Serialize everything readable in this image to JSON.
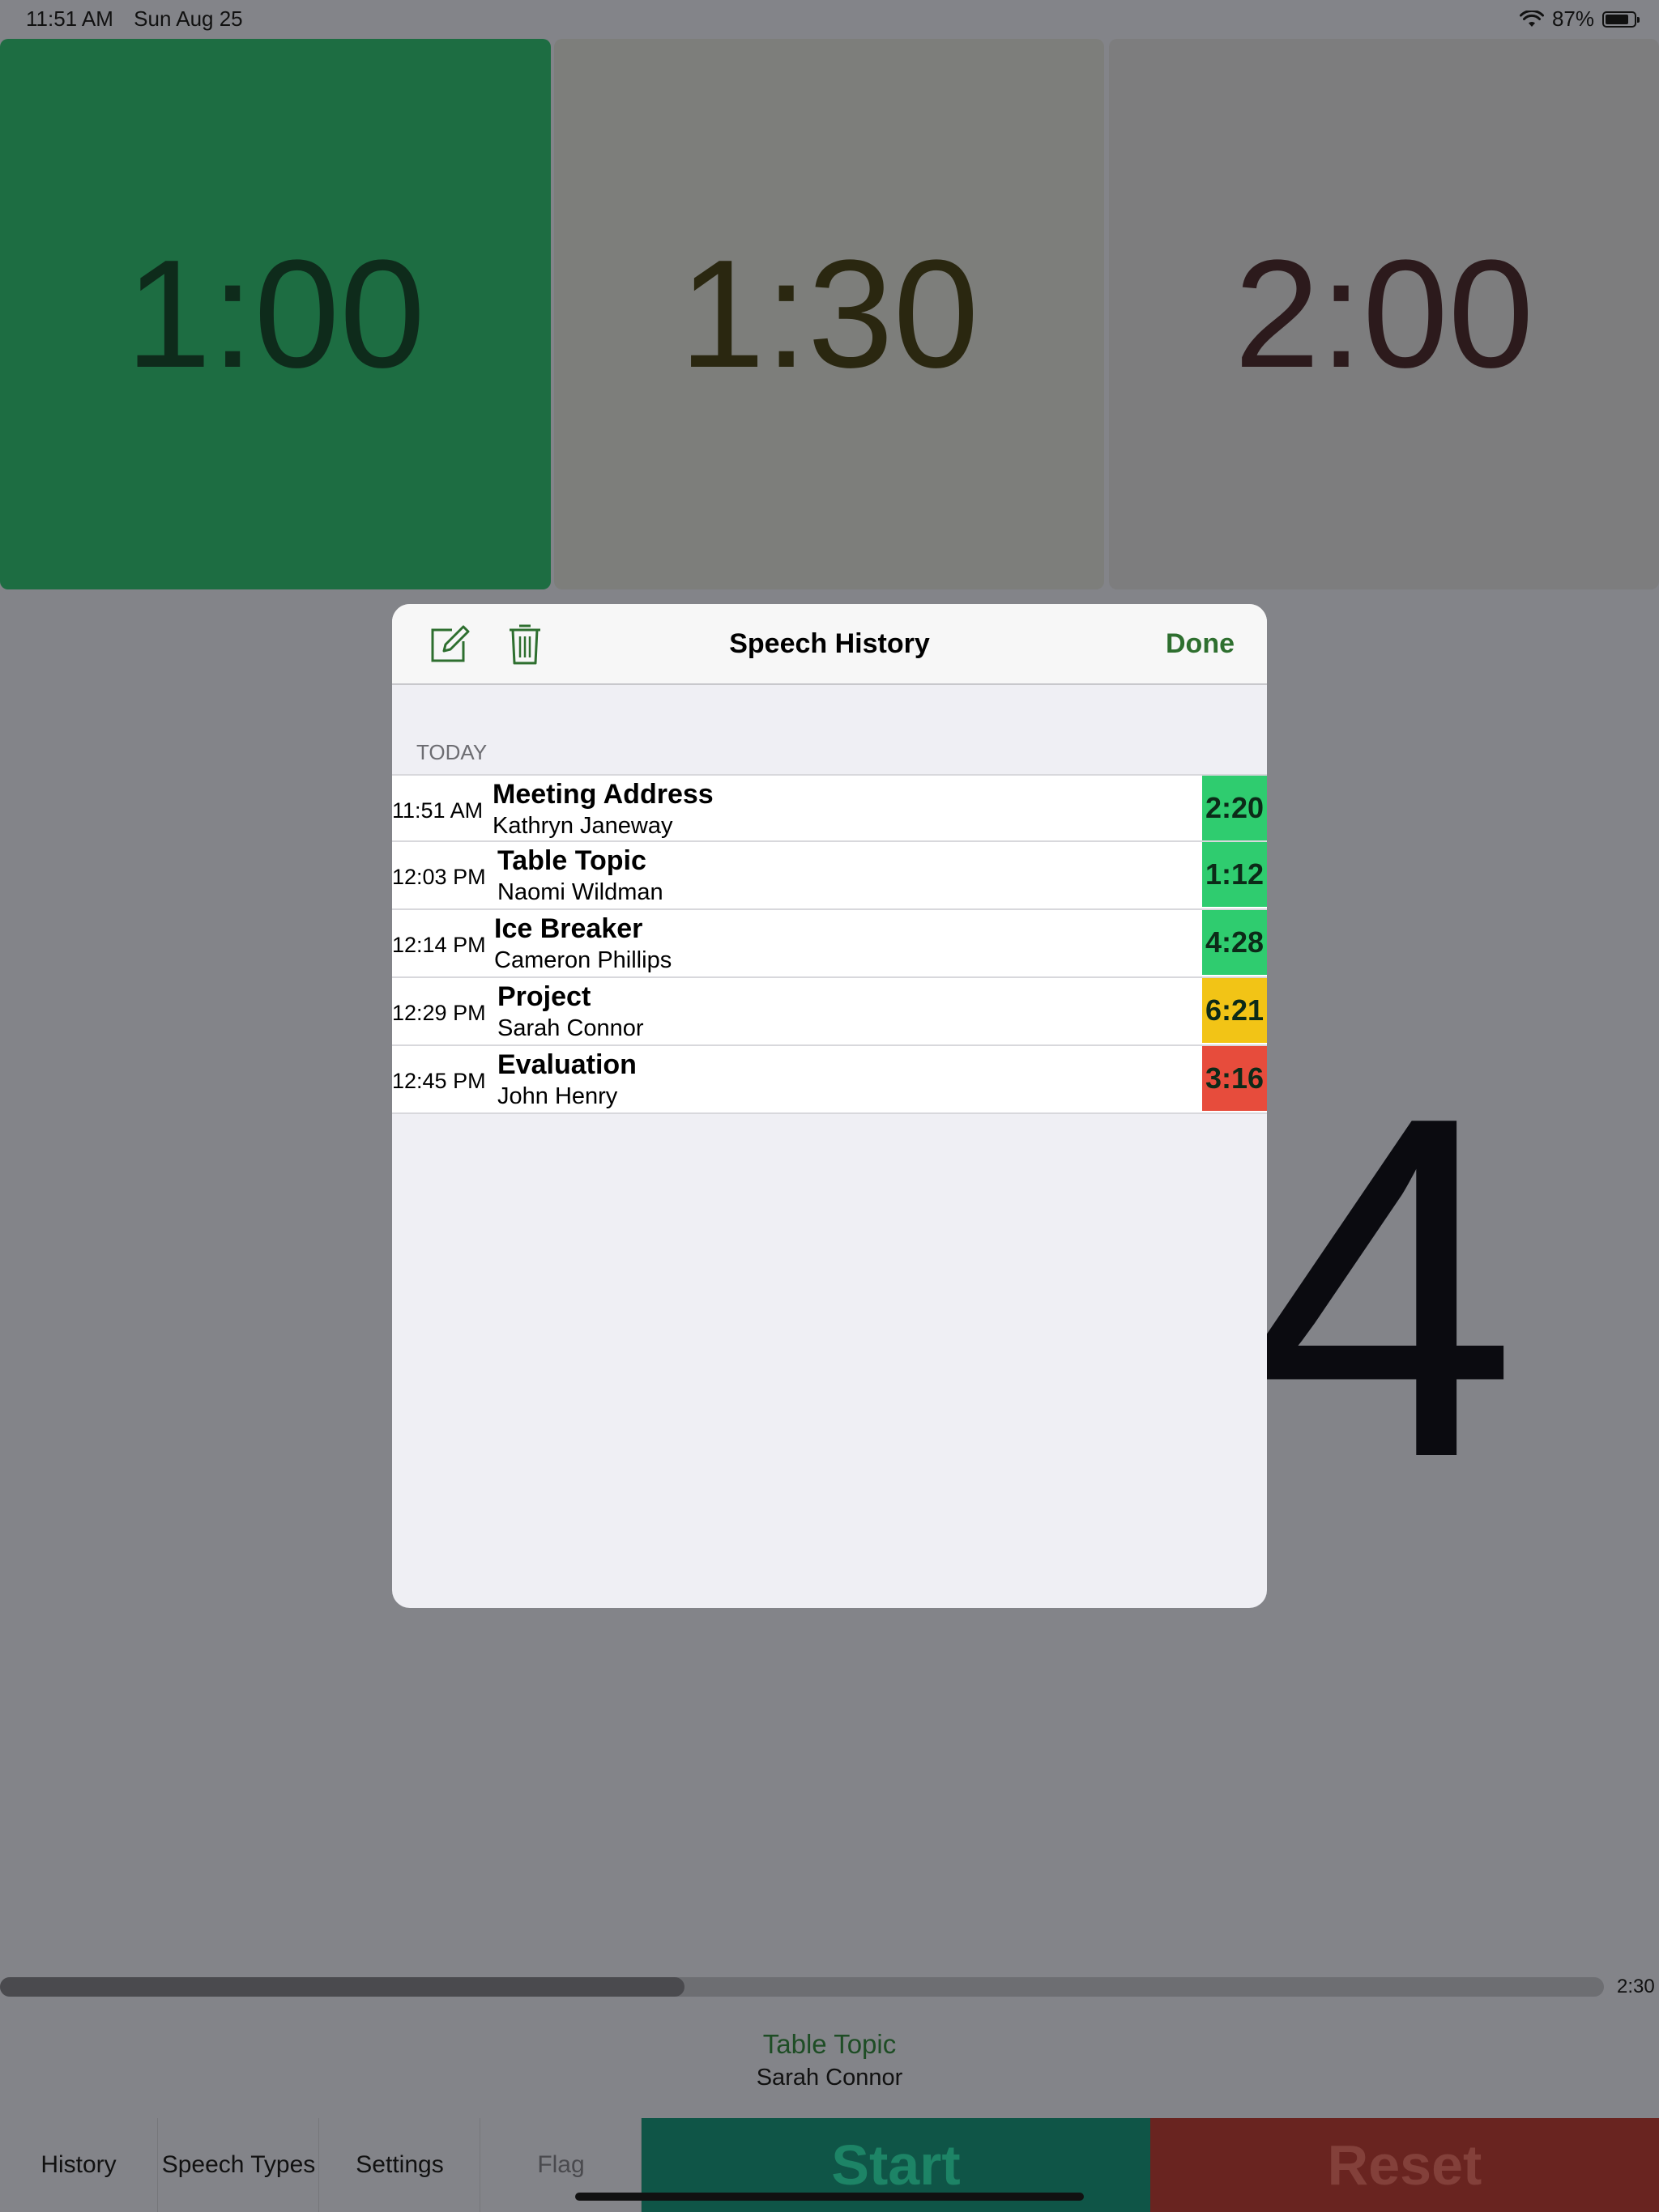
{
  "status_bar": {
    "time": "11:51 AM",
    "date": "Sun Aug 25",
    "battery_percent": "87%",
    "battery_level": 0.87
  },
  "timer_tiles": [
    {
      "label": "1:00",
      "color": "#1d6d42"
    },
    {
      "label": "1:30",
      "color": "#7d7e7b"
    },
    {
      "label": "2:00",
      "color": "#7d7d7e"
    }
  ],
  "main_clock_digit": "4",
  "progress": {
    "fraction": 0.4267,
    "end_label": "2:30"
  },
  "current_speech": {
    "type": "Table Topic",
    "speaker": "Sarah Connor"
  },
  "toolbar": {
    "history": "History",
    "speech_types": "Speech Types",
    "settings": "Settings",
    "flag": "Flag",
    "start": "Start",
    "reset": "Reset"
  },
  "modal": {
    "title": "Speech History",
    "done_label": "Done",
    "section_label": "TODAY",
    "rows": [
      {
        "time": "11:51 AM",
        "title": "Meeting Address",
        "speaker": "Kathryn Janeway",
        "duration": "2:20",
        "status_color": "#2fcc6f"
      },
      {
        "time": "12:03 PM",
        "title": "Table Topic",
        "speaker": "Naomi Wildman",
        "duration": "1:12",
        "status_color": "#2fcc6f"
      },
      {
        "time": "12:14 PM",
        "title": "Ice Breaker",
        "speaker": "Cameron Phillips",
        "duration": "4:28",
        "status_color": "#2fcc6f"
      },
      {
        "time": "12:29 PM",
        "title": "Project",
        "speaker": "Sarah Connor",
        "duration": "6:21",
        "status_color": "#f2c416"
      },
      {
        "time": "12:45 PM",
        "title": "Evaluation",
        "speaker": "John Henry",
        "duration": "3:16",
        "status_color": "#e74c3c"
      }
    ]
  },
  "icons": {
    "edit": "compose-icon",
    "delete": "trash-icon",
    "wifi": "wifi-icon",
    "battery": "battery-icon"
  }
}
